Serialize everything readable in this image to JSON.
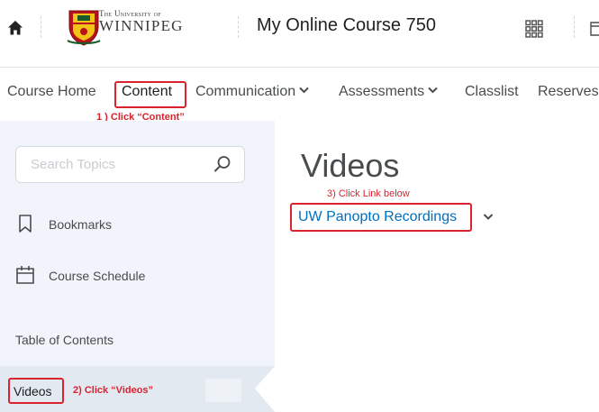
{
  "header": {
    "logo": {
      "small": "The University of",
      "big": "WINNIPEG"
    },
    "course_title": "My Online Course 750"
  },
  "nav": {
    "items": [
      {
        "label": "Course Home",
        "dropdown": false
      },
      {
        "label": "Content",
        "dropdown": false
      },
      {
        "label": "Communication",
        "dropdown": true
      },
      {
        "label": "Assessments",
        "dropdown": true
      },
      {
        "label": "Classlist",
        "dropdown": false
      },
      {
        "label": "Reserves",
        "dropdown": false
      }
    ]
  },
  "annotations": {
    "step1": "1 ) Click “Content”",
    "step2": "2) Click “Videos”",
    "step3": "3) Click Link below"
  },
  "sidebar": {
    "search_placeholder": "Search Topics",
    "bookmarks": "Bookmarks",
    "course_schedule": "Course Schedule",
    "toc_label": "Table of Contents",
    "videos": "Videos"
  },
  "main": {
    "title": "Videos",
    "link": "UW Panopto Recordings"
  },
  "colors": {
    "annotation_red": "#d9232e",
    "link_blue": "#006fbf",
    "sidebar_bg": "#f1f5fb"
  }
}
